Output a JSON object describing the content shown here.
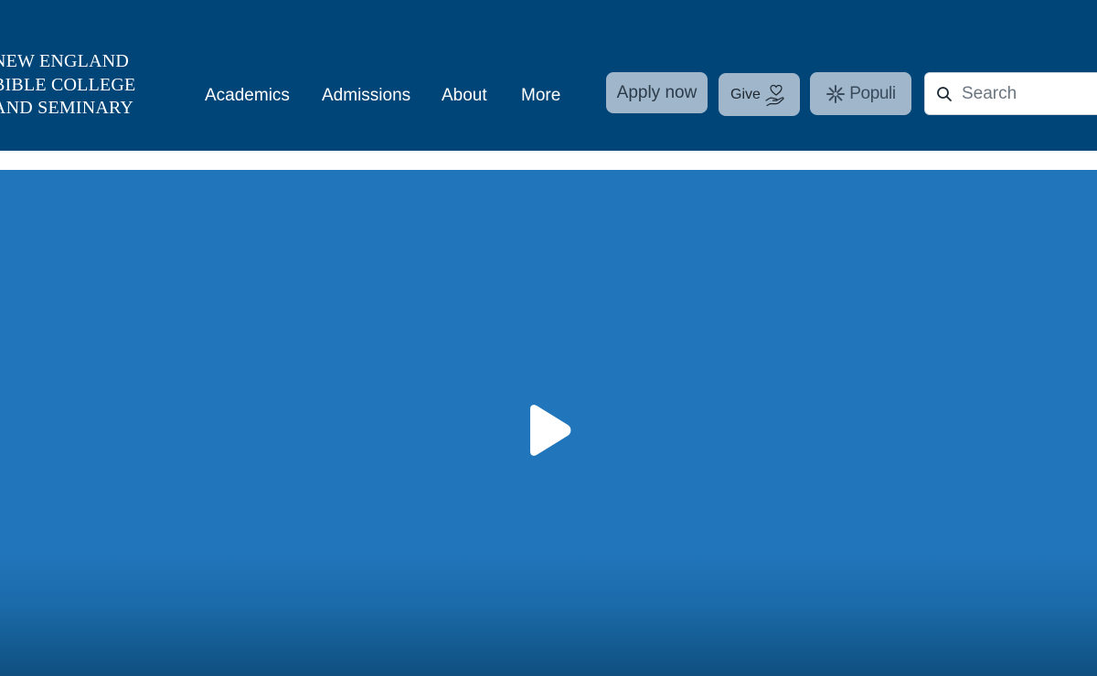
{
  "header": {
    "logo_lines": [
      "NEW ENGLAND",
      "BIBLE COLLEGE",
      "AND SEMINARY"
    ],
    "nav": [
      "Academics",
      "Admissions",
      "About",
      "More"
    ],
    "apply_label": "Apply now",
    "give_label": "Give",
    "populi_label": "Populi",
    "search": {
      "placeholder": "Search",
      "value": ""
    }
  },
  "icons": {
    "give": "hand-heart-icon",
    "populi": "populi-logo-icon",
    "search": "search-icon",
    "play": "play-icon"
  },
  "colors": {
    "header_bg": "#004578",
    "video_bg": "#2175bb",
    "button_bg": "#9fb6cb",
    "nav_text": "#ffffff"
  }
}
